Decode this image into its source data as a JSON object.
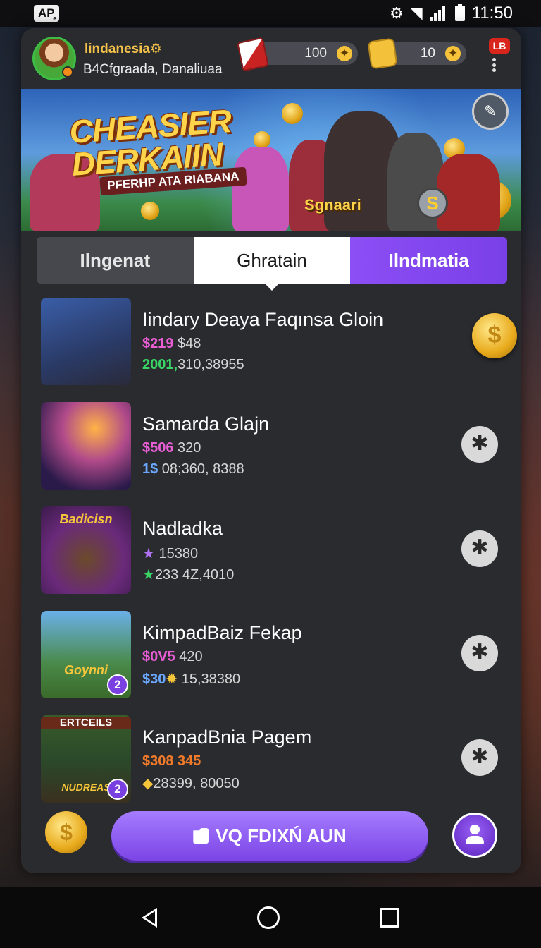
{
  "status_bar": {
    "left_badge": "AP̧",
    "time": "11:50"
  },
  "header": {
    "user_name": "lindanesia⚙",
    "user_subtitle": "B4Cfgraada, Danaliuaa",
    "currency_1_value": "100",
    "currency_2_value": "10",
    "plus_glyph": "✦",
    "lb_badge": "LB"
  },
  "banner": {
    "title_line1": "CHEASIER",
    "title_line2": "DERKAIIN",
    "subtitle": "PFERHP ATA RIABANA",
    "tag": "Sgnaari",
    "s_coin": "S"
  },
  "tabs": [
    {
      "label": "Ilngenat"
    },
    {
      "label": "Ghratain"
    },
    {
      "label": "Ilndmatia"
    }
  ],
  "items": [
    {
      "title": "Iindary Deaya Faqınsa Gloin",
      "line1_highlight": "$219",
      "line1_rest": " $48",
      "line2_highlight": "2001,",
      "line2_rest": "310,38955",
      "action": "$"
    },
    {
      "title": "Samarda Glajn",
      "line1_highlight": "$506",
      "line1_rest": " 320",
      "line2_highlight": "1$",
      "line2_rest": " 08;360, 8388",
      "action": "✱"
    },
    {
      "title": "Nadladka",
      "thumb_text": "Badicisn",
      "line1_highlight": "★",
      "line1_rest": " 15380",
      "line2_highlight": "★",
      "line2_rest": "233 4Z,4010",
      "action": "✱"
    },
    {
      "title": "KimpadBaiz Fekap",
      "thumb_text": "Goynni",
      "thumb_badge": "2",
      "line1_highlight": "$0V5",
      "line1_rest": " 420",
      "line2_highlight": "$30",
      "line2_icon": "✹",
      "line2_rest": " 15,38380",
      "action": "✱"
    },
    {
      "title": "KanpadBnia Pagem",
      "thumb_text": "ERTCEILS",
      "thumb_text_bottom": "NUDREAS",
      "thumb_badge": "2",
      "line1_highlight": "$308 345",
      "line1_rest": "",
      "line2_highlight": "◆",
      "line2_rest": "28399, 80050",
      "action": "✱"
    }
  ],
  "bottom": {
    "coin_glyph": "$",
    "cta_label": "VQ FDIXŃ AUN"
  },
  "icons": {
    "settings": "gear-icon",
    "wifi": "wifi-icon",
    "signal": "signal-icon",
    "battery": "battery-icon",
    "cards": "cards-icon",
    "block": "block-icon",
    "menu": "more-vertical-icon",
    "edit": "edit-icon",
    "close": "close-icon",
    "coin": "coin-icon",
    "folder": "folder-icon",
    "profile": "profile-icon",
    "back": "back-icon",
    "home": "home-icon",
    "recents": "recents-icon"
  },
  "colors": {
    "accent_purple": "#8c4ef5",
    "gold": "#f5c53a",
    "price_pink": "#e75ed5",
    "price_green": "#3bd466",
    "price_blue": "#6aa8ff",
    "price_orange": "#f07a2a"
  }
}
